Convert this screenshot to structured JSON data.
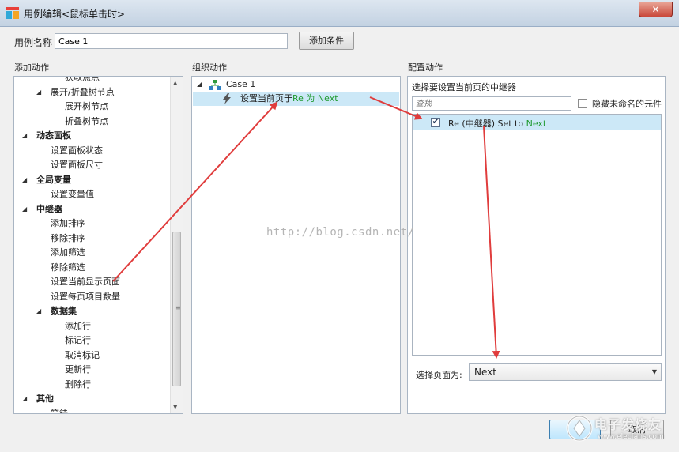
{
  "window": {
    "title": "用例编辑<鼠标单击时>",
    "close_label": "✕"
  },
  "case": {
    "label": "用例名称",
    "value": "Case 1",
    "add_condition_label": "添加条件"
  },
  "sections": {
    "add_action": "添加动作",
    "organize_action": "组织动作",
    "configure_action": "配置动作"
  },
  "left_tree": [
    {
      "label": "获取焦点",
      "level": 2,
      "bold": false,
      "expanded": null
    },
    {
      "label": "展开/折叠树节点",
      "level": 1,
      "bold": false,
      "expanded": true
    },
    {
      "label": "展开树节点",
      "level": 2,
      "bold": false,
      "expanded": null
    },
    {
      "label": "折叠树节点",
      "level": 2,
      "bold": false,
      "expanded": null
    },
    {
      "label": "动态面板",
      "level": 0,
      "bold": true,
      "expanded": true
    },
    {
      "label": "设置面板状态",
      "level": 1,
      "bold": false,
      "expanded": null
    },
    {
      "label": "设置面板尺寸",
      "level": 1,
      "bold": false,
      "expanded": null
    },
    {
      "label": "全局变量",
      "level": 0,
      "bold": true,
      "expanded": true
    },
    {
      "label": "设置变量值",
      "level": 1,
      "bold": false,
      "expanded": null
    },
    {
      "label": "中继器",
      "level": 0,
      "bold": true,
      "expanded": true
    },
    {
      "label": "添加排序",
      "level": 1,
      "bold": false,
      "expanded": null
    },
    {
      "label": "移除排序",
      "level": 1,
      "bold": false,
      "expanded": null
    },
    {
      "label": "添加筛选",
      "level": 1,
      "bold": false,
      "expanded": null
    },
    {
      "label": "移除筛选",
      "level": 1,
      "bold": false,
      "expanded": null
    },
    {
      "label": "设置当前显示页面",
      "level": 1,
      "bold": false,
      "expanded": null
    },
    {
      "label": "设置每页项目数量",
      "level": 1,
      "bold": false,
      "expanded": null
    },
    {
      "label": "数据集",
      "level": 1,
      "bold": true,
      "expanded": true
    },
    {
      "label": "添加行",
      "level": 2,
      "bold": false,
      "expanded": null
    },
    {
      "label": "标记行",
      "level": 2,
      "bold": false,
      "expanded": null
    },
    {
      "label": "取消标记",
      "level": 2,
      "bold": false,
      "expanded": null
    },
    {
      "label": "更新行",
      "level": 2,
      "bold": false,
      "expanded": null
    },
    {
      "label": "删除行",
      "level": 2,
      "bold": false,
      "expanded": null
    },
    {
      "label": "其他",
      "level": 0,
      "bold": true,
      "expanded": true
    },
    {
      "label": "等待",
      "level": 1,
      "bold": false,
      "expanded": null
    }
  ],
  "mid_tree": {
    "case_label": "Case 1",
    "action_prefix": "设置当前页于",
    "action_target": "Re 为 Next"
  },
  "right": {
    "select_title": "选择要设置当前页的中继器",
    "search_placeholder": "查找",
    "hide_unnamed_label": "隐藏未命名的元件",
    "repeater_prefix": "Re (中继器) Set to",
    "repeater_value": "Next",
    "repeater_checked": true,
    "page_label": "选择页面为:",
    "page_value": "Next"
  },
  "buttons": {
    "cancel_label": "取消"
  },
  "watermark": {
    "text": "http://blog.csdn.net/",
    "logo_big": "电子发烧友",
    "logo_small": "www.elecfans.com"
  },
  "colors": {
    "accent_green": "#1f9a2f",
    "selection": "#cce8f7",
    "arrow_red": "#e03c3c"
  }
}
